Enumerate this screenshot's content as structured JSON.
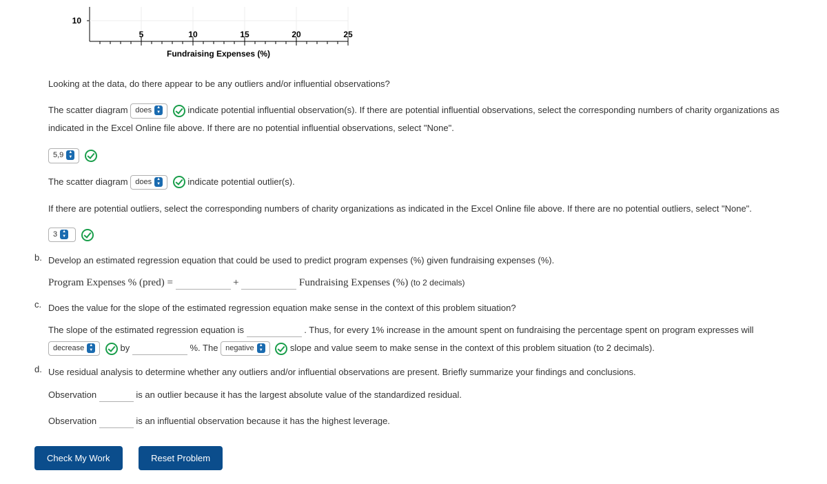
{
  "chart_data": {
    "type": "scatter",
    "title": "",
    "xlabel": "Fundraising Expenses (%)",
    "ylabel": "",
    "xlim": [
      0,
      25
    ],
    "ylim": [
      10,
      null
    ],
    "xticks": [
      5,
      10,
      15,
      20,
      25
    ],
    "yticks": [
      10
    ],
    "series": []
  },
  "intro_q": "Looking at the data, do there appear to be any outliers and/or influential observations?",
  "line1": {
    "pre": "The scatter diagram",
    "sel": "does",
    "post": "indicate potential influential observation(s). If there are potential influential observations, select the corresponding numbers of charity organizations as indicated in the Excel Online file above. If there are no potential influential observations, select \"None\"."
  },
  "ans1": "5,9",
  "line2": {
    "pre": "The scatter diagram",
    "sel": "does",
    "post": "indicate potential outlier(s)."
  },
  "line2_extra": "If there are potential outliers, select the corresponding numbers of charity organizations as indicated in the Excel Online file above. If there are no potential outliers, select \"None\".",
  "ans2": "3",
  "part_b": {
    "marker": "b.",
    "text": "Develop an estimated regression equation that could be used to predict program expenses (%) given fundraising expenses (%).",
    "eq_lhs": "Program Expenses % (pred) =",
    "plus": "+",
    "eq_rhs": "Fundraising Expenses (%)",
    "tail": "(to 2 decimals)"
  },
  "part_c": {
    "marker": "c.",
    "text": "Does the value for the slope of the estimated regression equation make sense in the context of this problem situation?",
    "l1_pre": "The slope of the estimated regression equation is",
    "l1_post": ". Thus, for every 1% increase in the amount spent on fundraising the percentage spent on program expresses will",
    "sel_decrease": "decrease",
    "by": "by",
    "pct_the": "%. The",
    "sel_negative": "negative",
    "l2_post": "slope and value seem to make sense in the context of this problem situation (to 2 decimals)."
  },
  "part_d": {
    "marker": "d.",
    "text": "Use residual analysis to determine whether any outliers and/or influential observations are present. Briefly summarize your findings and conclusions.",
    "obs1": "Observation",
    "obs1_post": "is an outlier because it has the largest absolute value of the standardized residual.",
    "obs2": "Observation",
    "obs2_post": "is an influential observation because it has the highest leverage."
  },
  "buttons": {
    "check": "Check My Work",
    "reset": "Reset Problem"
  }
}
